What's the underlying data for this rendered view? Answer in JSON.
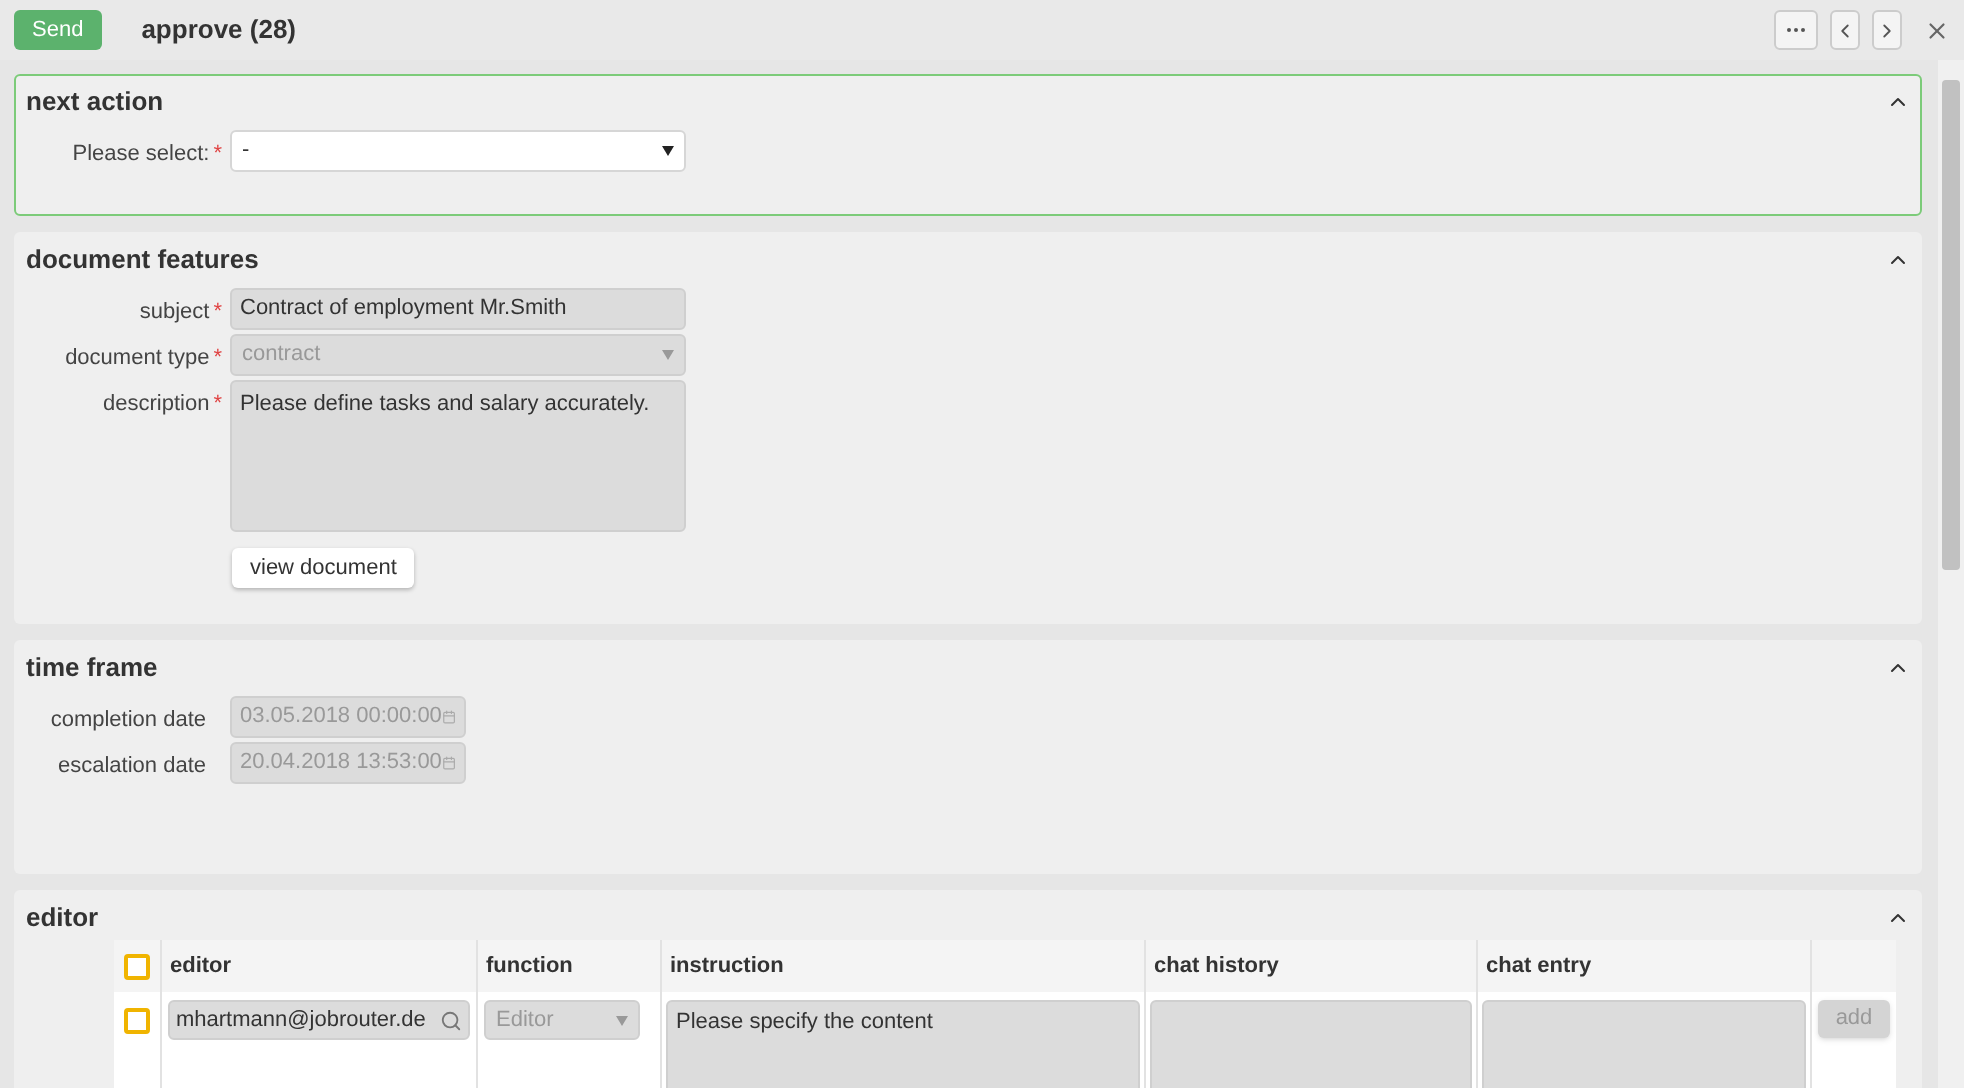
{
  "toolbar": {
    "send_label": "Send",
    "title": "approve (28)"
  },
  "sections": [
    {
      "kind": "form",
      "title": "next action",
      "expanded": true,
      "active": true,
      "fields": [
        {
          "kind": "select",
          "label": "Please select:",
          "required_mark": "*",
          "disabled": false,
          "value": "-"
        }
      ]
    },
    {
      "kind": "form",
      "title": "document features",
      "expanded": true,
      "active": false,
      "fields": [
        {
          "kind": "text",
          "label": "subject",
          "required_mark": "*",
          "disabled": true,
          "value": "Contract of employment Mr.Smith"
        },
        {
          "kind": "select",
          "label": "document type",
          "required_mark": "*",
          "disabled": true,
          "value": "contract"
        },
        {
          "kind": "textarea",
          "label": "description",
          "required_mark": "*",
          "disabled": true,
          "value": "Please define tasks and salary accurately."
        }
      ],
      "button": "view document"
    },
    {
      "kind": "form",
      "title": "time frame",
      "expanded": true,
      "active": false,
      "fields": [
        {
          "kind": "date",
          "label": "completion date",
          "disabled": true,
          "value": "03.05.2018 00:00:00"
        },
        {
          "kind": "date",
          "label": "escalation date",
          "disabled": true,
          "value": "20.04.2018 13:53:00"
        }
      ]
    },
    {
      "kind": "table",
      "title": "editor",
      "expanded": true,
      "active": false,
      "header_checked": false,
      "columns": [
        "editor",
        "function",
        "instruction",
        "chat history",
        "chat entry"
      ],
      "rows": [
        {
          "checked": false,
          "editor": "mhartmann@jobrouter.de",
          "function": "Editor",
          "instruction": "Please specify the content",
          "add_label": "add",
          "add_disabled": true
        }
      ]
    }
  ]
}
